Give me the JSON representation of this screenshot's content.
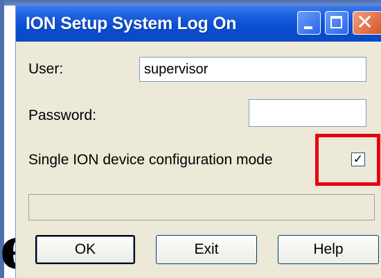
{
  "window": {
    "title": "ION Setup System Log On",
    "min_icon": "minimize-icon",
    "max_icon": "maximize-icon",
    "close_icon": "close-icon",
    "close_glyph": "✕"
  },
  "form": {
    "user_label": "User:",
    "user_value": "supervisor",
    "password_label": "Password:",
    "password_value": "",
    "single_mode_label": "Single ION device configuration mode",
    "single_mode_checked": true,
    "check_glyph": "✓"
  },
  "buttons": {
    "ok": "OK",
    "exit": "Exit",
    "help": "Help"
  },
  "annotation": {
    "color": "#e8000f"
  },
  "background": {
    "glyph": "e"
  }
}
